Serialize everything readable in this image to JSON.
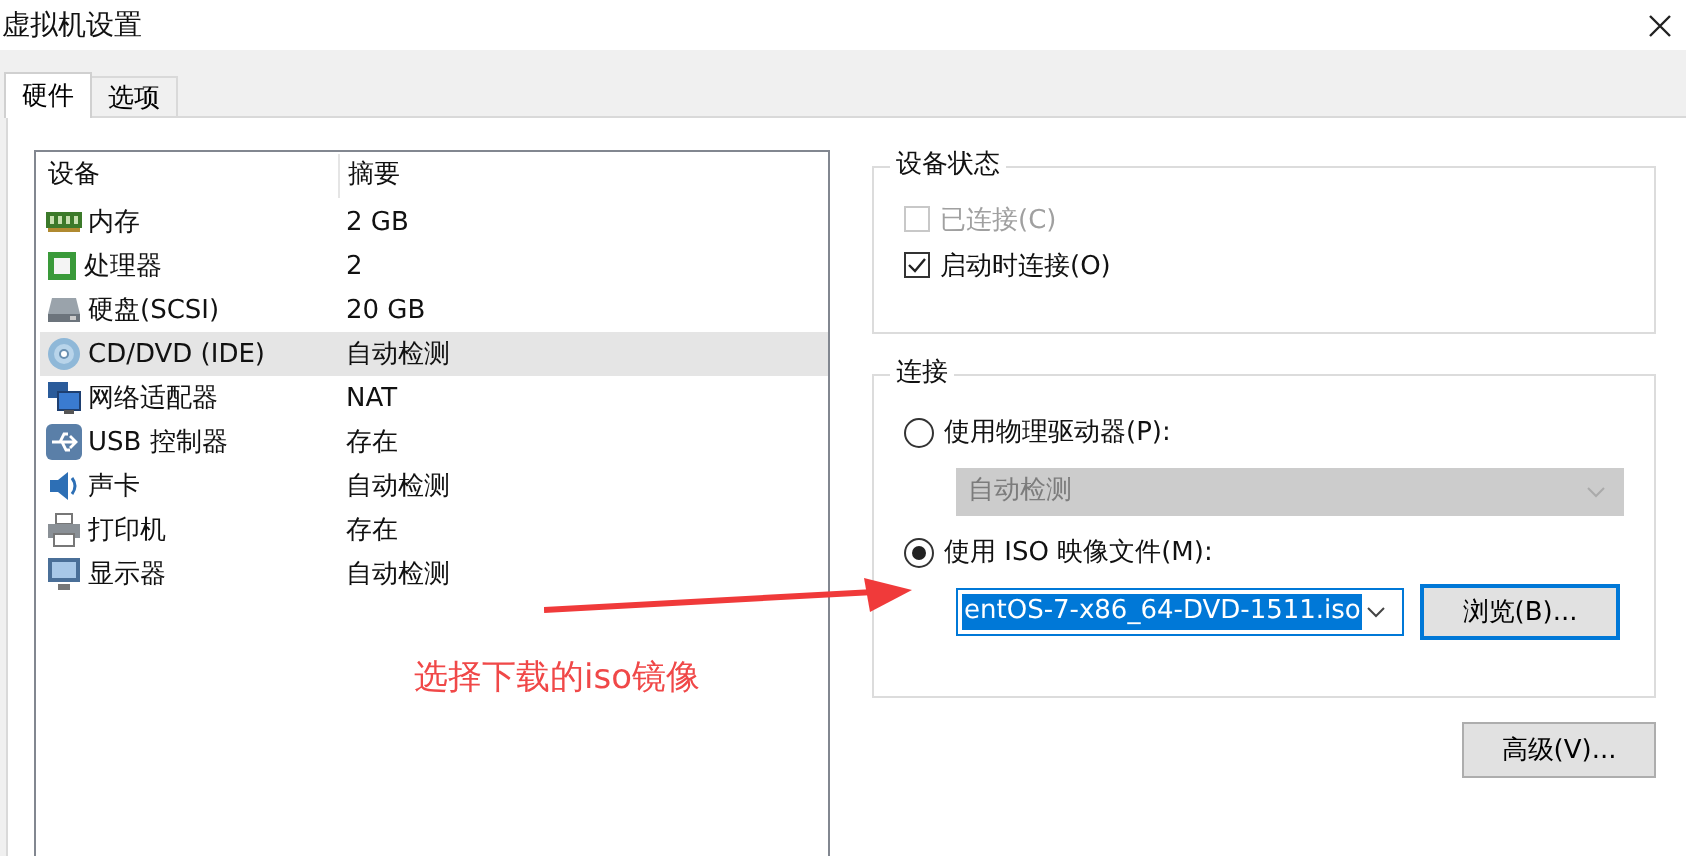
{
  "window": {
    "title": "虚拟机设置"
  },
  "tabs": [
    {
      "label": "硬件",
      "selected": true
    },
    {
      "label": "选项",
      "selected": false
    }
  ],
  "device_list": {
    "columns": [
      "设备",
      "摘要"
    ],
    "rows": [
      {
        "kind": "memory",
        "device": "内存",
        "summary": "2 GB",
        "selected": false
      },
      {
        "kind": "cpu",
        "device": "处理器",
        "summary": "2",
        "selected": false
      },
      {
        "kind": "disk",
        "device": "硬盘(SCSI)",
        "summary": "20 GB",
        "selected": false
      },
      {
        "kind": "cd",
        "device": "CD/DVD (IDE)",
        "summary": "自动检测",
        "selected": true
      },
      {
        "kind": "network",
        "device": "网络适配器",
        "summary": "NAT",
        "selected": false
      },
      {
        "kind": "usb",
        "device": "USB 控制器",
        "summary": "存在",
        "selected": false
      },
      {
        "kind": "sound",
        "device": "声卡",
        "summary": "自动检测",
        "selected": false
      },
      {
        "kind": "printer",
        "device": "打印机",
        "summary": "存在",
        "selected": false
      },
      {
        "kind": "display",
        "device": "显示器",
        "summary": "自动检测",
        "selected": false
      }
    ]
  },
  "device_status": {
    "title": "设备状态",
    "options": [
      {
        "label": "已连接(C)",
        "checked": false,
        "disabled": true
      },
      {
        "label": "启动时连接(O)",
        "checked": true,
        "disabled": false
      }
    ]
  },
  "connection": {
    "title": "连接",
    "options": [
      {
        "label": "使用物理驱动器(P):",
        "selected": false,
        "dropdown": {
          "value": "自动检测",
          "disabled": true
        }
      },
      {
        "label": "使用 ISO 映像文件(M):",
        "selected": true,
        "dropdown": {
          "value": "entOS-7-x86_64-DVD-1511.iso",
          "disabled": false
        },
        "button": "浏览(B)..."
      }
    ]
  },
  "advanced_button": "高级(V)...",
  "annotation": {
    "text": "选择下载的iso镜像"
  }
}
